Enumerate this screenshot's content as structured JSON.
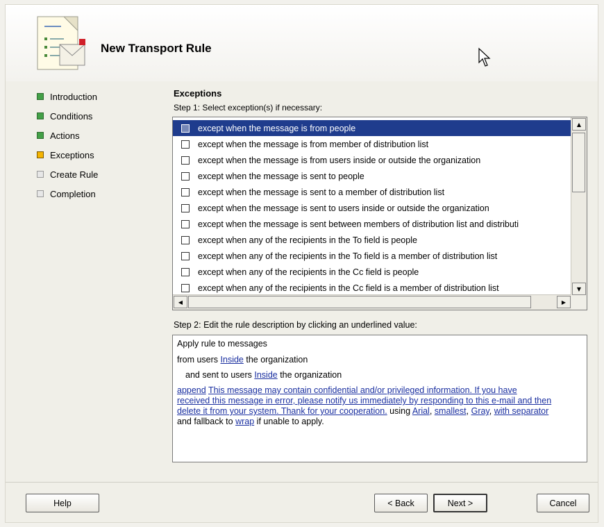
{
  "wizard": {
    "title": "New Transport Rule"
  },
  "nav": {
    "items": [
      {
        "label": "Introduction",
        "state": "done"
      },
      {
        "label": "Conditions",
        "state": "done"
      },
      {
        "label": "Actions",
        "state": "done"
      },
      {
        "label": "Exceptions",
        "state": "current"
      },
      {
        "label": "Create Rule",
        "state": "pending"
      },
      {
        "label": "Completion",
        "state": "pending"
      }
    ]
  },
  "exceptions": {
    "heading": "Exceptions",
    "step1_label": "Step 1: Select exception(s) if necessary:",
    "items": [
      {
        "label": "except when the message is from people",
        "selected": true
      },
      {
        "label": "except when the message is from member of distribution list",
        "selected": false
      },
      {
        "label": "except when the message is from users inside or outside the organization",
        "selected": false
      },
      {
        "label": "except when the message is sent to people",
        "selected": false
      },
      {
        "label": "except when the message is sent to a member of distribution list",
        "selected": false
      },
      {
        "label": "except when the message is sent to users inside or outside the organization",
        "selected": false
      },
      {
        "label": "except when the message is sent between members of distribution list and distributi",
        "selected": false
      },
      {
        "label": "except when any of the recipients in the To field is people",
        "selected": false
      },
      {
        "label": "except when any of the recipients in the To field is a member of distribution list",
        "selected": false
      },
      {
        "label": "except when any of the recipients in the Cc field is people",
        "selected": false
      },
      {
        "label": "except when any of the recipients in the Cc field is a member of distribution list",
        "selected": false
      }
    ],
    "step2_label": "Step 2: Edit the rule description by clicking an underlined value:"
  },
  "description": {
    "line1": "Apply rule to messages",
    "line2_pre": "from users ",
    "line2_link": "Inside",
    "line2_post": " the organization",
    "line3_pre": "and sent to users ",
    "line3_link": "Inside",
    "line3_post": " the organization",
    "append_link": "append",
    "disclaimer_link": "This message may contain confidential and/or privileged information. If you have received this message in error, please notify us immediately by responding to this e-mail and then delete it from your system. Thank for your cooperation.",
    "using_text": " using ",
    "font_link": "Arial",
    "size_link": "smallest",
    "color_link": "Gray",
    "separator_link": "with separator",
    "fallback_text": " and fallback to ",
    "fallback_link": "wrap",
    "tail_text": " if unable to apply.",
    "comma": ", "
  },
  "buttons": {
    "help": "Help",
    "back": "< Back",
    "next": "Next >",
    "cancel": "Cancel"
  },
  "colors": {
    "selection": "#1f3c8d",
    "link": "#1a2fa0",
    "step_done": "#43a047",
    "step_current": "#f5b400"
  }
}
